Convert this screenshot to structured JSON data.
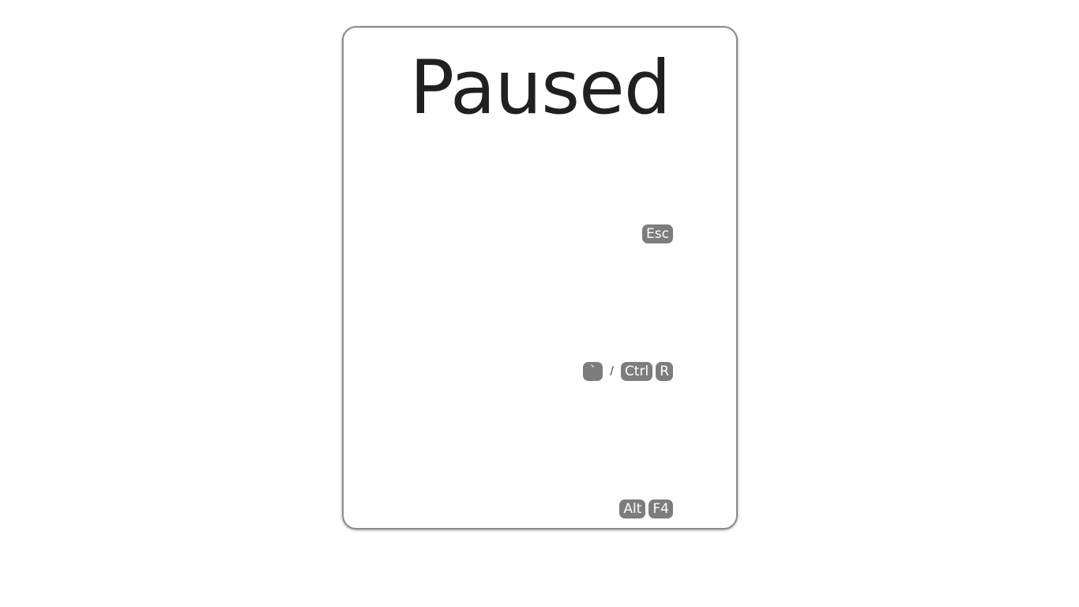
{
  "pause_menu": {
    "title": "Paused",
    "items": [
      {
        "id": "resume",
        "label": "",
        "keys": [
          "Esc"
        ]
      },
      {
        "id": "restart",
        "label": "",
        "keys": [
          "`"
        ],
        "separator": "/",
        "alt_keys": [
          "Ctrl",
          "R"
        ]
      },
      {
        "id": "quit",
        "label": "",
        "keys": [
          "Alt",
          "F4"
        ]
      }
    ]
  },
  "colors": {
    "background": "#ffffff",
    "panel_border": "#8a8a8a",
    "key_background": "#7d7d7d",
    "key_text": "#ffffff",
    "title_text": "#202020"
  }
}
